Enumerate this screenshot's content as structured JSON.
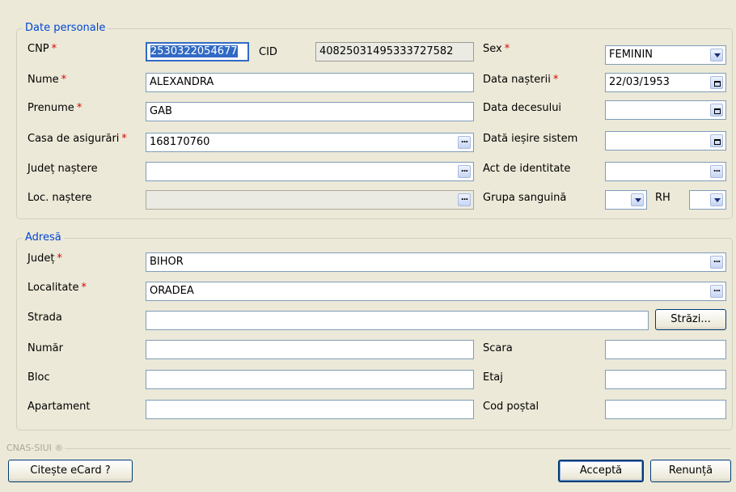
{
  "personal": {
    "legend": "Date personale",
    "cnp_label": "CNP",
    "cnp_value": "2530322054677",
    "cid_label": "CID",
    "cid_value": "40825031495333727582",
    "sex_label": "Sex",
    "sex_value": "FEMININ",
    "nume_label": "Nume",
    "nume_value": "ALEXANDRA",
    "data_nasterii_label": "Data nașterii",
    "data_nasterii_value": "22/03/1953",
    "prenume_label": "Prenume",
    "prenume_value": "GAB",
    "data_decesului_label": "Data decesului",
    "data_decesului_value": "",
    "casa_label": "Casa de asigurări",
    "casa_value": "168170760",
    "iesire_label": "Dată ieșire sistem",
    "iesire_value": "",
    "judet_nastere_label": "Județ naștere",
    "judet_nastere_value": "",
    "act_label": "Act de identitate",
    "act_value": "",
    "loc_nastere_label": "Loc. naștere",
    "loc_nastere_value": "",
    "grupa_label": "Grupa sanguină",
    "grupa_value": "",
    "rh_label": "RH",
    "rh_value": "",
    "required_marker": "*"
  },
  "address": {
    "legend": "Adresă",
    "judet_label": "Județ",
    "judet_value": "BIHOR",
    "localitate_label": "Localitate",
    "localitate_value": "ORADEA",
    "strada_label": "Strada",
    "strada_value": "",
    "strazi_button": "Străzi...",
    "numar_label": "Număr",
    "numar_value": "",
    "scara_label": "Scara",
    "scara_value": "",
    "bloc_label": "Bloc",
    "bloc_value": "",
    "etaj_label": "Etaj",
    "etaj_value": "",
    "apartament_label": "Apartament",
    "apartament_value": "",
    "cod_postal_label": "Cod poștal",
    "cod_postal_value": ""
  },
  "footer": {
    "brand": "CNAS-SIUI ®",
    "citeste_button": "Citește eCard ?",
    "accepta_button": "Acceptă",
    "renunta_button": "Renunță"
  }
}
